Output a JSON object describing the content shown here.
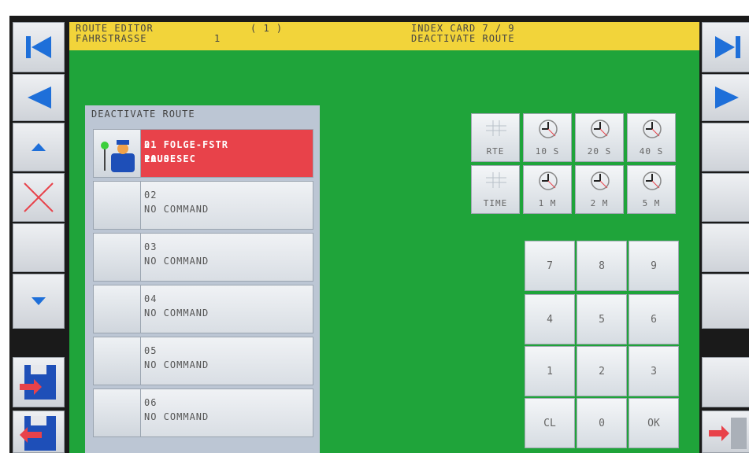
{
  "header": {
    "left_line1": "ROUTE EDITOR",
    "left_line2": "FAHRSTRASSE",
    "number_line1": "( 1 )",
    "number_line2": "1",
    "right_line1": "INDEX CARD 7 / 9",
    "right_line2": "DEACTIVATE ROUTE"
  },
  "panel": {
    "title": "DEACTIVATE ROUTE",
    "rows": [
      {
        "line1": "01 FOLGE-FSTR",
        "line1_value": "2",
        "line2": "PAUSE",
        "line2_value": "10.0 SEC",
        "active": true
      },
      {
        "line1": "02",
        "line2": "NO COMMAND"
      },
      {
        "line1": "03",
        "line2": "NO COMMAND"
      },
      {
        "line1": "04",
        "line2": "NO COMMAND"
      },
      {
        "line1": "05",
        "line2": "NO COMMAND"
      },
      {
        "line1": "06",
        "line2": "NO COMMAND"
      }
    ]
  },
  "time_buttons": {
    "row1": [
      "RTE",
      "10 S",
      "20 S",
      "40 S"
    ],
    "row2": [
      "TIME",
      "1 M",
      "2 M",
      "5 M"
    ]
  },
  "keypad": [
    "7",
    "8",
    "9",
    "4",
    "5",
    "6",
    "1",
    "2",
    "3",
    "CL",
    "0",
    "OK"
  ],
  "left_buttons": [
    "first-page-icon",
    "previous-page-icon",
    "arrow-up-icon",
    "delete-x-icon",
    "blank",
    "arrow-down-icon",
    "save-export-icon",
    "import-icon"
  ],
  "right_buttons": [
    "last-page-icon",
    "next-page-icon",
    "blank",
    "blank",
    "blank",
    "blank",
    "blank",
    "exit-door-icon"
  ],
  "colors": {
    "screen_green": "#1fa43a",
    "header_yellow": "#f2d43a",
    "active_row_red": "#e8424a",
    "nav_blue": "#1e6fd9"
  }
}
